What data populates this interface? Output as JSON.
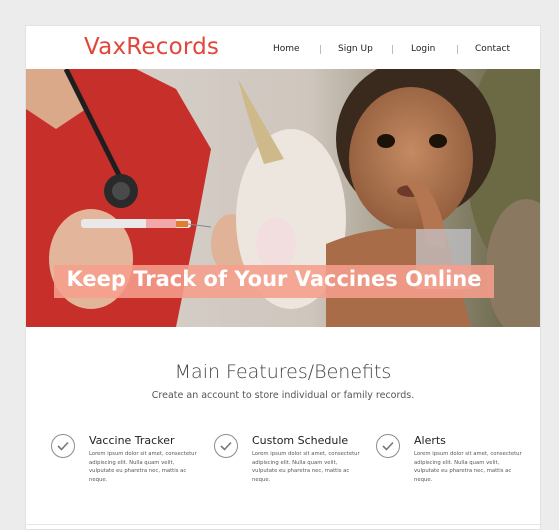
{
  "brand": {
    "name": "VaxRecords",
    "color": "#e2463a"
  },
  "nav": {
    "items": [
      {
        "label": "Home"
      },
      {
        "label": "Sign Up"
      },
      {
        "label": "Login"
      },
      {
        "label": "Contact"
      }
    ]
  },
  "hero": {
    "headline": "Keep Track of Your Vaccines Online",
    "banner_color": "#f69e8c"
  },
  "features": {
    "title": "Main Features/Benefits",
    "subtitle": "Create an account to store individual or family records.",
    "items": [
      {
        "icon": "check-circle-icon",
        "title": "Vaccine Tracker",
        "body": "Lorem ipsum dolor sit amet, consectetur adipiscing elit. Nulla quam velit, vulputate eu pharetra nec, mattis ac neque."
      },
      {
        "icon": "check-circle-icon",
        "title": "Custom Schedule",
        "body": "Lorem ipsum dolor sit amet, consectetur adipiscing elit. Nulla quam velit, vulputate eu pharetra nec, mattis ac neque."
      },
      {
        "icon": "check-circle-icon",
        "title": "Alerts",
        "body": "Lorem ipsum dolor sit amet, consectetur adipiscing elit. Nulla quam velit, vulputate eu pharetra nec, mattis ac neque."
      }
    ]
  }
}
